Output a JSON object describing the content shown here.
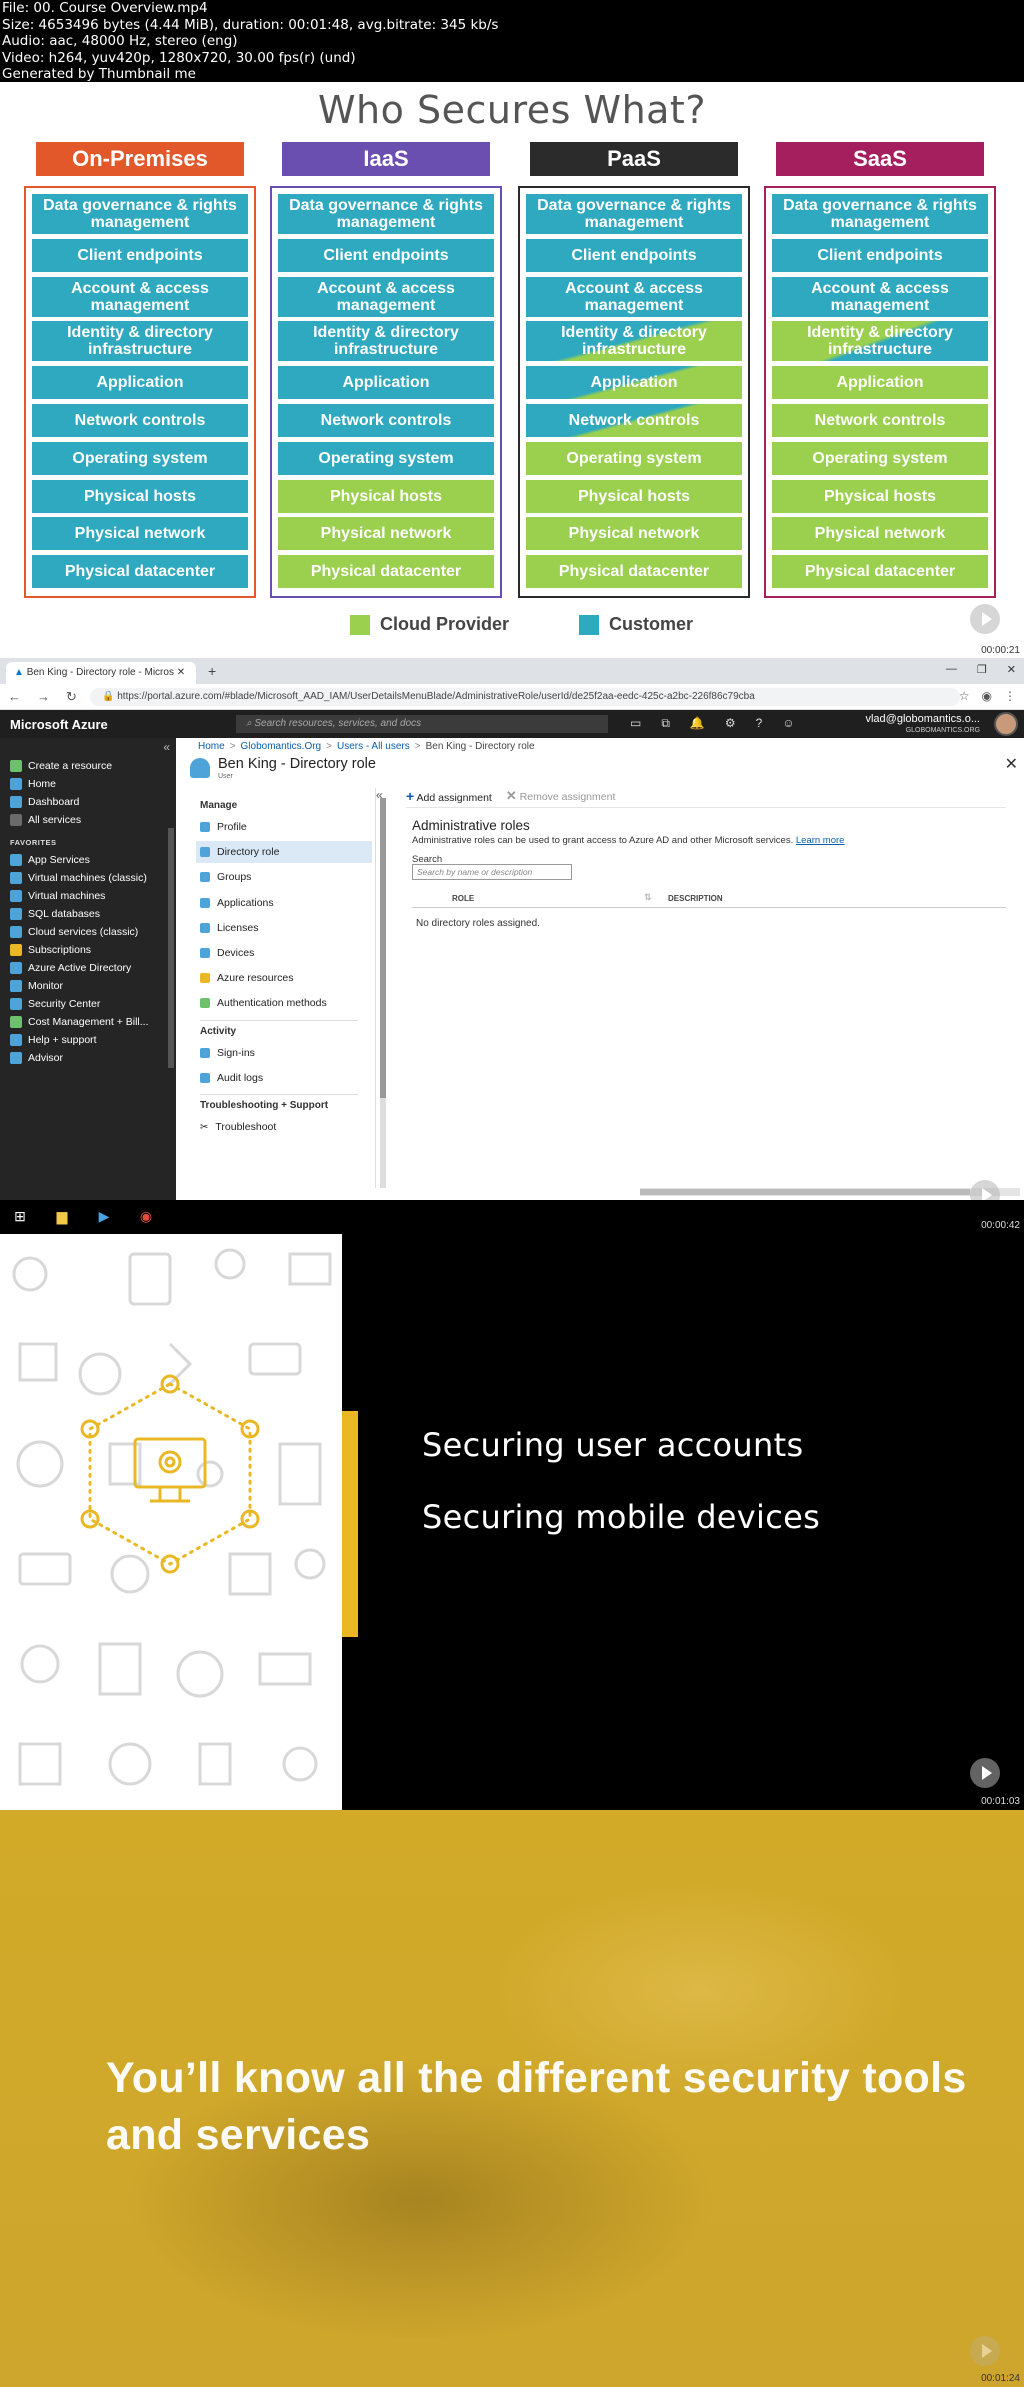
{
  "meta": {
    "lines": [
      "File: 00. Course Overview.mp4",
      "Size: 4653496 bytes (4.44 MiB), duration: 00:01:48, avg.bitrate: 345 kb/s",
      "Audio: aac, 48000 Hz, stereo (eng)",
      "Video: h264, yuv420p, 1280x720, 30.00 fps(r) (und)",
      "Generated by Thumbnail me"
    ]
  },
  "frame1": {
    "title": "Who Secures What?",
    "timestamp": "00:00:21",
    "columns": [
      {
        "name": "On-Premises",
        "head_color": "#e3582a",
        "border_color": "#e3582a"
      },
      {
        "name": "IaaS",
        "head_color": "#6a4fb0",
        "border_color": "#6a4fb0"
      },
      {
        "name": "PaaS",
        "head_color": "#2b2b2b",
        "border_color": "#2b2b2b"
      },
      {
        "name": "SaaS",
        "head_color": "#a51f5e",
        "border_color": "#a51f5e"
      }
    ],
    "layers": [
      "Data governance & rights management",
      "Client endpoints",
      "Account & access management",
      "Identity & directory infrastructure",
      "Application",
      "Network controls",
      "Operating system",
      "Physical hosts",
      "Physical network",
      "Physical datacenter"
    ],
    "legend": {
      "provider": "Cloud Provider",
      "customer": "Customer",
      "provider_color": "#9bd04e",
      "customer_color": "#2ea9bf"
    }
  },
  "frame2": {
    "timestamp": "00:00:42",
    "tab_title": "Ben King - Directory role - Micros",
    "url": "https://portal.azure.com/#blade/Microsoft_AAD_IAM/UserDetailsMenuBlade/AdministrativeRole/userId/de25f2aa-eedc-425c-a2bc-226f86c79cba",
    "portal_name": "Microsoft Azure",
    "search_placeholder": "Search resources, services, and docs",
    "user_email": "vlad@globomantics.o...",
    "user_org": "GLOBOMANTICS.ORG",
    "sidebar": [
      "Create a resource",
      "Home",
      "Dashboard",
      "All services",
      "FAVORITES",
      "App Services",
      "Virtual machines (classic)",
      "Virtual machines",
      "SQL databases",
      "Cloud services (classic)",
      "Subscriptions",
      "Azure Active Directory",
      "Monitor",
      "Security Center",
      "Cost Management + Bill...",
      "Help + support",
      "Advisor"
    ],
    "breadcrumbs": [
      "Home",
      "Globomantics.Org",
      "Users - All users",
      "Ben King - Directory role"
    ],
    "blade_title": "Ben King - Directory role",
    "blade_subtitle": "User",
    "nav": {
      "manage_label": "Manage",
      "manage": [
        "Profile",
        "Directory role",
        "Groups",
        "Applications",
        "Licenses",
        "Devices",
        "Azure resources",
        "Authentication methods"
      ],
      "activity_label": "Activity",
      "activity": [
        "Sign-ins",
        "Audit logs"
      ],
      "support_label": "Troubleshooting + Support",
      "support": [
        "Troubleshoot"
      ]
    },
    "cmd_add": "Add assignment",
    "cmd_remove": "Remove assignment",
    "admin_heading": "Administrative roles",
    "admin_desc": "Administrative roles can be used to grant access to Azure AD and other Microsoft services.",
    "learn_more": "Learn more",
    "search_label": "Search",
    "search_box_placeholder": "Search by name or description",
    "col_role": "ROLE",
    "col_desc": "DESCRIPTION",
    "empty_text": "No directory roles assigned."
  },
  "frame3": {
    "timestamp": "00:01:03",
    "line1": "Securing user accounts",
    "line2": "Securing mobile devices",
    "accent": "#e9b824"
  },
  "frame4": {
    "timestamp": "00:01:24",
    "text": "You’ll know all the different security tools and services"
  }
}
